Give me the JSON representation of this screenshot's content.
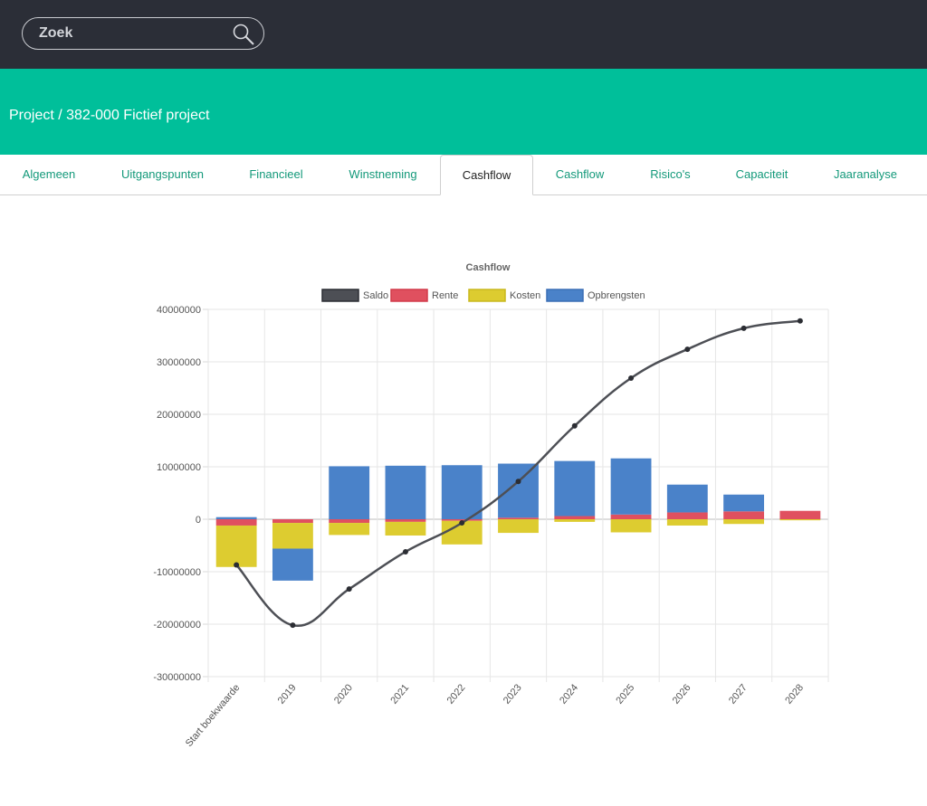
{
  "header": {
    "search": {
      "placeholder": "Zoek",
      "icon": "search-icon"
    }
  },
  "breadcrumb": {
    "text": "Project / 382-000 Fictief project"
  },
  "tabs": [
    {
      "label": "Algemeen",
      "active": false
    },
    {
      "label": "Uitgangspunten",
      "active": false
    },
    {
      "label": "Financieel",
      "active": false
    },
    {
      "label": "Winstneming",
      "active": false
    },
    {
      "label": "Cashflow",
      "active": true
    },
    {
      "label": "Cashflow",
      "active": false
    },
    {
      "label": "Risico's",
      "active": false
    },
    {
      "label": "Capaciteit",
      "active": false
    },
    {
      "label": "Jaaranalyse",
      "active": false
    }
  ],
  "colors": {
    "topbar": "#2b2e37",
    "banner": "#00bf9a",
    "tab_link": "#13997a",
    "saldo": "#4d4f55",
    "rente": "#e0505f",
    "kosten": "#ddcc30",
    "opbrengsten": "#4a82c9"
  },
  "chart_data": {
    "type": "bar",
    "title": "Cashflow",
    "legend_position": "top",
    "grid": true,
    "categories": [
      "Start boekwaarde",
      "2019",
      "2020",
      "2021",
      "2022",
      "2023",
      "2024",
      "2025",
      "2026",
      "2027",
      "2028"
    ],
    "yticks": [
      "40000000",
      "30000000",
      "20000000",
      "10000000",
      "0",
      "-10000000",
      "-20000000",
      "-30000000"
    ],
    "ylim": [
      -30000000,
      40000000
    ],
    "series": [
      {
        "name": "Saldo",
        "type": "line",
        "values": [
          -8700000,
          -20200000,
          -13300000,
          -6200000,
          -700000,
          7200000,
          17800000,
          26900000,
          32400000,
          36400000,
          37800000
        ]
      },
      {
        "name": "Rente",
        "type": "bar",
        "values": [
          -1200000,
          -700000,
          -700000,
          -500000,
          -300000,
          300000,
          600000,
          900000,
          1300000,
          1500000,
          1600000
        ]
      },
      {
        "name": "Kosten",
        "type": "bar",
        "values": [
          -7900000,
          -4900000,
          -2300000,
          -2600000,
          -4500000,
          -2600000,
          -500000,
          -2500000,
          -1200000,
          -900000,
          -200000
        ]
      },
      {
        "name": "Opbrengsten",
        "type": "bar",
        "values": [
          400000,
          -6100000,
          10100000,
          10200000,
          10300000,
          10300000,
          10500000,
          10700000,
          5300000,
          3200000,
          0
        ]
      }
    ]
  }
}
